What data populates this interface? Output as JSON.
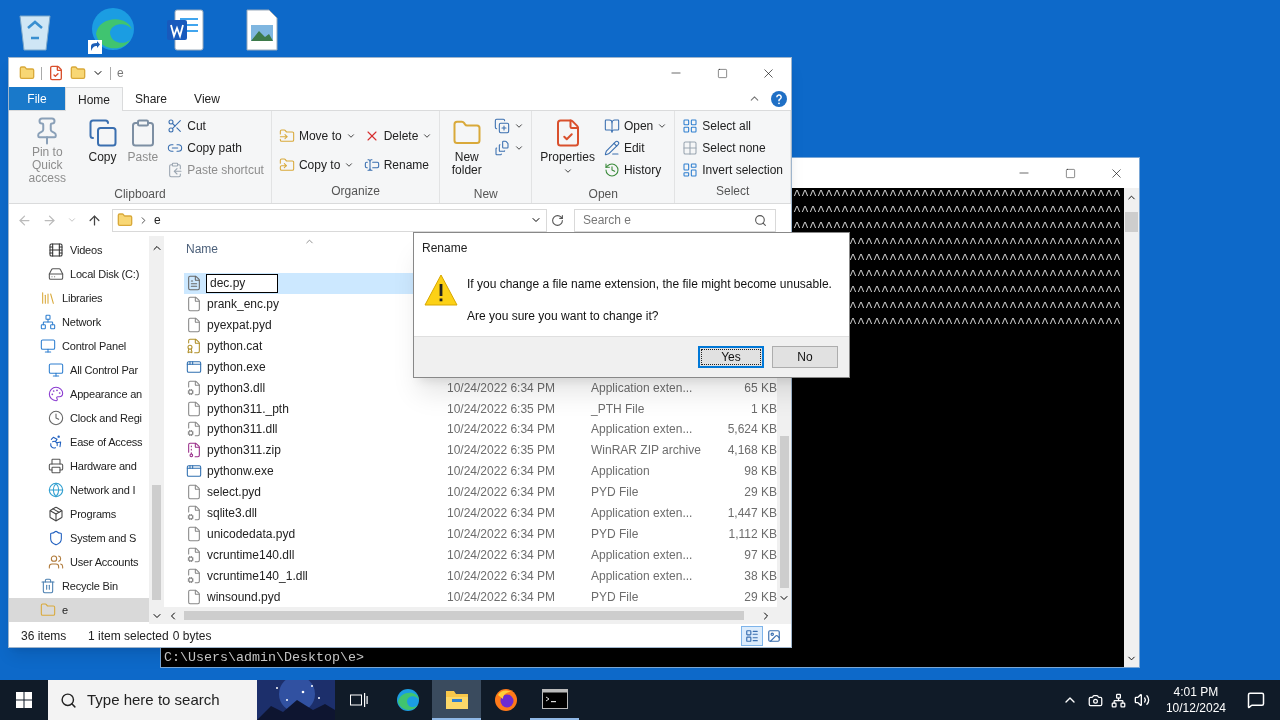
{
  "explorer": {
    "title": "e",
    "tabs": [
      {
        "label": "File",
        "kind": "file",
        "selected": false
      },
      {
        "label": "Home",
        "kind": "tab",
        "selected": true
      },
      {
        "label": "Share",
        "kind": "tab",
        "selected": false
      },
      {
        "label": "View",
        "kind": "tab",
        "selected": false
      }
    ],
    "ribbon": [
      {
        "label": "Clipboard",
        "columns": [
          {
            "kind": "large",
            "items": [
              {
                "label": "Pin to Quick access",
                "disabled": true,
                "dropdown": false
              }
            ]
          },
          {
            "kind": "large",
            "items": [
              {
                "label": "Copy",
                "disabled": false,
                "dropdown": false
              }
            ]
          },
          {
            "kind": "large",
            "items": [
              {
                "label": "Paste",
                "disabled": true,
                "dropdown": false
              }
            ]
          },
          {
            "kind": "stack",
            "items": [
              {
                "label": "Cut",
                "disabled": false,
                "dropdown": false
              },
              {
                "label": "Copy path",
                "disabled": false,
                "dropdown": false
              },
              {
                "label": "Paste shortcut",
                "disabled": true,
                "dropdown": false
              }
            ]
          }
        ]
      },
      {
        "label": "Organize",
        "columns": [
          {
            "kind": "stack",
            "items": [
              {
                "label": "Move to",
                "disabled": false,
                "dropdown": true
              },
              {
                "label": "Copy to",
                "disabled": false,
                "dropdown": true
              }
            ]
          },
          {
            "kind": "stack",
            "items": [
              {
                "label": "Delete",
                "disabled": false,
                "dropdown": true
              },
              {
                "label": "Rename",
                "disabled": false,
                "dropdown": false
              }
            ]
          }
        ]
      },
      {
        "label": "New",
        "columns": [
          {
            "kind": "large",
            "items": [
              {
                "label": "New folder",
                "disabled": false,
                "dropdown": false
              }
            ]
          },
          {
            "kind": "stack",
            "items": [
              {
                "disabled": false,
                "dropdown": true
              },
              {
                "disabled": false,
                "dropdown": true
              }
            ]
          }
        ]
      },
      {
        "label": "Open",
        "columns": [
          {
            "kind": "large",
            "items": [
              {
                "label": "Properties",
                "disabled": false,
                "dropdown": true
              }
            ]
          },
          {
            "kind": "stack",
            "items": [
              {
                "label": "Open",
                "disabled": false,
                "dropdown": true
              },
              {
                "label": "Edit",
                "disabled": false,
                "dropdown": false
              },
              {
                "label": "History",
                "disabled": false,
                "dropdown": false
              }
            ]
          }
        ]
      },
      {
        "label": "Select",
        "columns": [
          {
            "kind": "stack",
            "items": [
              {
                "label": "Select all",
                "disabled": false,
                "dropdown": false
              },
              {
                "label": "Select none",
                "disabled": false,
                "dropdown": false
              },
              {
                "label": "Invert selection",
                "disabled": false,
                "dropdown": false
              }
            ]
          }
        ]
      }
    ],
    "address": {
      "path": "e",
      "search_placeholder": "Search e"
    },
    "nav_pane": {
      "continued_items": [
        {
          "label": "Videos",
          "selected": false
        },
        {
          "label": "Local Disk (C:)",
          "selected": false
        }
      ],
      "items": [
        {
          "label": "Libraries",
          "selected": false
        },
        {
          "label": "Network",
          "selected": false
        },
        {
          "label": "Control Panel",
          "selected": false,
          "children": [
            {
              "label": "All Control Par",
              "selected": false
            },
            {
              "label": "Appearance an",
              "selected": false
            },
            {
              "label": "Clock and Regi",
              "selected": false
            },
            {
              "label": "Ease of Access",
              "selected": false
            },
            {
              "label": "Hardware and",
              "selected": false
            },
            {
              "label": "Network and I",
              "selected": false
            },
            {
              "label": "Programs",
              "selected": false
            },
            {
              "label": "System and S",
              "selected": false
            },
            {
              "label": "User Accounts",
              "selected": false
            }
          ]
        },
        {
          "label": "Recycle Bin",
          "selected": false
        },
        {
          "label": "e",
          "selected": true
        }
      ]
    },
    "name_column": {
      "label": "Name",
      "sorted": true
    },
    "files": [
      {
        "name": "dec.py",
        "selected": true,
        "editing": true
      },
      {
        "name": "prank_enc.py",
        "selected": false,
        "editing": false
      },
      {
        "name": "pyexpat.pyd",
        "selected": false,
        "editing": false
      },
      {
        "name": "python.cat",
        "selected": false,
        "editing": false
      },
      {
        "name": "python.exe",
        "selected": false,
        "editing": false
      },
      {
        "name": "python3.dll",
        "selected": false,
        "editing": false,
        "date": "10/24/2022 6:34 PM",
        "type": "Application exten...",
        "size": "65 KB"
      },
      {
        "name": "python311._pth",
        "selected": false,
        "editing": false,
        "date": "10/24/2022 6:35 PM",
        "type": "_PTH File",
        "size": "1 KB"
      },
      {
        "name": "python311.dll",
        "selected": false,
        "editing": false,
        "date": "10/24/2022 6:34 PM",
        "type": "Application exten...",
        "size": "5,624 KB"
      },
      {
        "name": "python311.zip",
        "selected": false,
        "editing": false,
        "date": "10/24/2022 6:35 PM",
        "type": "WinRAR ZIP archive",
        "size": "4,168 KB"
      },
      {
        "name": "pythonw.exe",
        "selected": false,
        "editing": false,
        "date": "10/24/2022 6:34 PM",
        "type": "Application",
        "size": "98 KB"
      },
      {
        "name": "select.pyd",
        "selected": false,
        "editing": false,
        "date": "10/24/2022 6:34 PM",
        "type": "PYD File",
        "size": "29 KB"
      },
      {
        "name": "sqlite3.dll",
        "selected": false,
        "editing": false,
        "date": "10/24/2022 6:34 PM",
        "type": "Application exten...",
        "size": "1,447 KB"
      },
      {
        "name": "unicodedata.pyd",
        "selected": false,
        "editing": false,
        "date": "10/24/2022 6:34 PM",
        "type": "PYD File",
        "size": "1,112 KB"
      },
      {
        "name": "vcruntime140.dll",
        "selected": false,
        "editing": false,
        "date": "10/24/2022 6:34 PM",
        "type": "Application exten...",
        "size": "97 KB"
      },
      {
        "name": "vcruntime140_1.dll",
        "selected": false,
        "editing": false,
        "date": "10/24/2022 6:34 PM",
        "type": "Application exten...",
        "size": "38 KB"
      },
      {
        "name": "winsound.pyd",
        "selected": false,
        "editing": false,
        "date": "10/24/2022 6:34 PM",
        "type": "PYD File",
        "size": "29 KB"
      }
    ],
    "status": {
      "count": "36 items",
      "selection": "1 item selected",
      "size": "0 bytes"
    },
    "views": [
      {
        "selected": true
      },
      {
        "selected": false
      }
    ]
  },
  "console": {
    "lines": [
      "^^^^^^^^^^^^^^^^^^^^^^^^^^^^^^^^^^^^^^^^^",
      "^^^^^^^^^^^^^^^^^^^^^^^^^^^^^^^^^^^^^^^^^",
      "^^^^^^^^^^^^^^^^^^^^^^^^^^^^^^^^^^^^^^^^^",
      "^^^^^^^^^^^^^^^^^^^^^^^^^^^^^^^^^^",
      "^^^^^^^^^^^^^^^^^^^^^^^^^^^^^^^^^^",
      "^^^^^^^^^^^^^^^^^^^^^^^^^^^^^^^^^^",
      "^^^^^^^^^^^^^^^^^^^^^^^^^^^^^^^^^^",
      "^^^^^^^^^^^^^^^^^^^^^^^^^^^^^^^^^^",
      "^^^^^^^^^^^^^^^^^^^^^^^^^^^^^^^^^^"
    ],
    "prompt": "C:\\Users\\admin\\Desktop\\e>"
  },
  "dialog": {
    "title": "Rename",
    "message": "If you change a file name extension, the file might become unusable.",
    "question": "Are you sure you want to change it?",
    "buttons": [
      {
        "label": "Yes",
        "focused": true
      },
      {
        "label": "No",
        "focused": false
      }
    ]
  },
  "taskbar": {
    "search_placeholder": "Type here to search",
    "apps": [
      {
        "running": false,
        "active": false
      },
      {
        "running": true,
        "active": true
      },
      {
        "running": false,
        "active": false
      },
      {
        "running": true,
        "active": false
      }
    ],
    "time": "4:01 PM",
    "date": "10/12/2024"
  }
}
